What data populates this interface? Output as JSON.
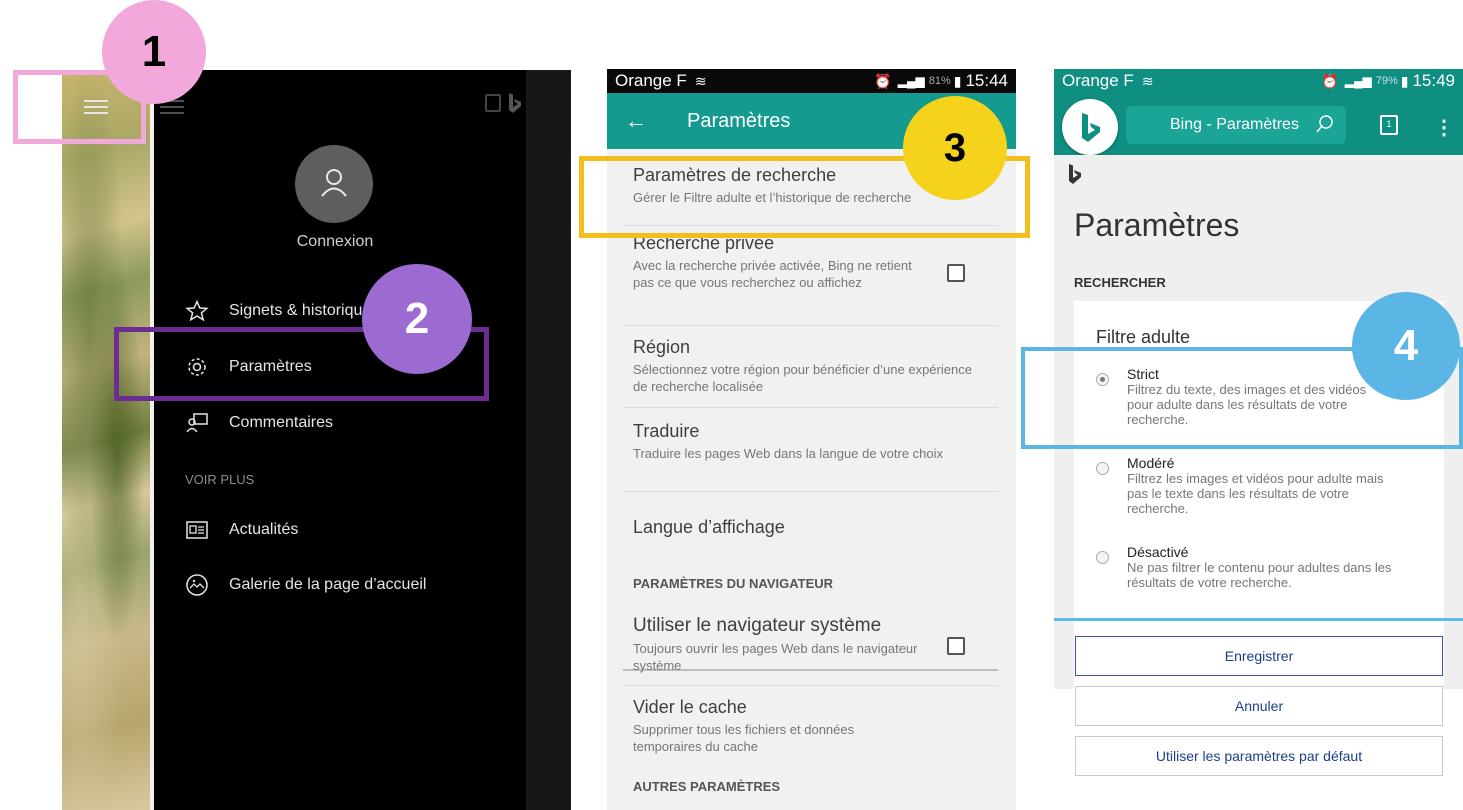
{
  "panel1": {
    "connexion": "Connexion",
    "menu": [
      {
        "label": "Signets & historique",
        "icon": "star-icon"
      },
      {
        "label": "Paramètres",
        "icon": "gear-icon"
      },
      {
        "label": "Commentaires",
        "icon": "feedback-icon"
      }
    ],
    "section": "VOIR PLUS",
    "more": [
      {
        "label": "Actualités",
        "icon": "news-icon"
      },
      {
        "label": "Galerie de la page d’accueil",
        "icon": "gallery-icon"
      }
    ]
  },
  "panel2": {
    "status": {
      "carrier": "Orange F",
      "battery": "81%",
      "time": "15:44"
    },
    "title": "Paramètres",
    "items": [
      {
        "title": "Paramètres de recherche",
        "desc": "Gérer le Filtre adulte et l’historique de recherche"
      },
      {
        "title": "Recherche privée",
        "desc": "Avec la recherche privée activée, Bing ne retient pas ce que vous recherchez ou affichez"
      },
      {
        "title": "Région",
        "desc": "Sélectionnez votre région pour bénéficier d’une expérience de recherche localisée"
      },
      {
        "title": "Traduire",
        "desc": "Traduire les pages Web dans la langue de votre choix"
      },
      {
        "title": "Langue d’affichage",
        "desc": ""
      }
    ],
    "browser_section": "PARAMÈTRES DU NAVIGATEUR",
    "browser_items": [
      {
        "title": "Utiliser le navigateur système",
        "desc": "Toujours ouvrir les pages Web dans le navigateur système"
      },
      {
        "title": "Vider le cache",
        "desc": "Supprimer tous les fichiers et données temporaires du cache"
      }
    ],
    "other_section": "AUTRES PARAMÈTRES"
  },
  "panel3": {
    "status": {
      "carrier": "Orange F",
      "battery": "79%",
      "time": "15:49"
    },
    "search_text": "Bing - Paramètres",
    "tab_count": "1",
    "title": "Paramètres",
    "section": "RECHERCHER",
    "filter_title": "Filtre adulte",
    "options": [
      {
        "label": "Strict",
        "desc": "Filtrez du texte, des images et des vidéos pour adulte dans les résultats de votre recherche.",
        "selected": true
      },
      {
        "label": "Modéré",
        "desc": "Filtrez les images et vidéos pour adulte mais pas le texte dans les résultats de votre recherche.",
        "selected": false
      },
      {
        "label": "Désactivé",
        "desc": "Ne pas filtrer le contenu pour adultes dans les résultats de votre recherche.",
        "selected": false
      }
    ],
    "buttons": {
      "save": "Enregistrer",
      "cancel": "Annuler",
      "default": "Utiliser les paramètres par défaut"
    }
  },
  "badges": [
    "1",
    "2",
    "3",
    "4"
  ],
  "colors": {
    "badge1": "#f3a8dc",
    "badge2": "#9b6bd2",
    "badge3": "#f5d31c",
    "badge4": "#5bb6e6",
    "appbar": "#149a8f"
  }
}
